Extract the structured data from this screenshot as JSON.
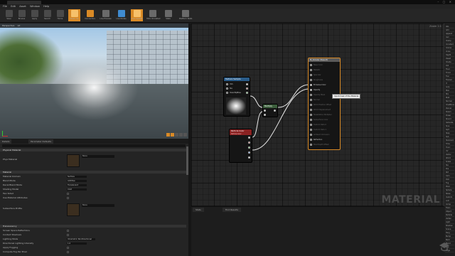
{
  "window": {
    "title_tab": "M_Smoke"
  },
  "menu": {
    "items": [
      "File",
      "Edit",
      "Asset",
      "Window",
      "Help"
    ]
  },
  "toolbar": {
    "buttons": [
      {
        "label": "Save",
        "icon": "save-icon"
      },
      {
        "label": "Browse",
        "icon": "browse-icon"
      },
      {
        "label": "Apply",
        "icon": "apply-icon"
      },
      {
        "label": "Search",
        "icon": "search-icon"
      },
      {
        "label": "Home",
        "icon": "home-icon"
      },
      {
        "label": "Clean Up",
        "icon": "cleanup-icon"
      },
      {
        "label": "Connectors",
        "icon": "connectors-icon"
      },
      {
        "label": "Live Preview",
        "icon": "live-preview-icon"
      },
      {
        "label": "Live Nodes",
        "icon": "live-nodes-icon"
      },
      {
        "label": "Live Update",
        "icon": "live-update-icon"
      },
      {
        "label": "Hide Unrelated",
        "icon": "hide-unrelated-icon"
      },
      {
        "label": "Stats",
        "icon": "stats-icon"
      },
      {
        "label": "Platform Stats",
        "icon": "platform-stats-icon"
      }
    ]
  },
  "viewport": {
    "labels": [
      "Perspective",
      "Lit"
    ]
  },
  "details": {
    "tabs": [
      "Details",
      "Parameter Defaults"
    ],
    "sections": {
      "physical": "Physical Material",
      "material": "Material",
      "translucency": "Translucency"
    },
    "physical_rows": [
      {
        "label": "Phys Material",
        "value": "None"
      }
    ],
    "material_rows": [
      {
        "label": "Material Domain",
        "value": "Surface",
        "kind": "select"
      },
      {
        "label": "Blend Mode",
        "value": "Additive",
        "kind": "select"
      },
      {
        "label": "Decal Blend Mode",
        "value": "Translucent",
        "kind": "select"
      },
      {
        "label": "Shading Model",
        "value": "Unlit",
        "kind": "select"
      },
      {
        "label": "Two Sided",
        "value": "",
        "kind": "check"
      },
      {
        "label": "Use Material Attributes",
        "value": "",
        "kind": "check"
      },
      {
        "label": "Subsurface Profile",
        "value": "None",
        "kind": "thumb"
      }
    ],
    "translucency_rows": [
      {
        "label": "Screen Space Reflections",
        "kind": "check"
      },
      {
        "label": "Contact Shadows",
        "kind": "check"
      },
      {
        "label": "Lighting Mode",
        "kind": "select",
        "value": "Volumetric NonDirectional"
      },
      {
        "label": "Directional Lighting Intensity",
        "kind": "select",
        "value": "1.0"
      },
      {
        "label": "Apply Fogging",
        "kind": "check"
      },
      {
        "label": "Compute Fog Per Pixel",
        "kind": "check"
      }
    ]
  },
  "graph": {
    "zoom": "Zoom 1:1",
    "watermark": "MATERIAL",
    "texture_node": {
      "title": "Texture Sample",
      "pins": [
        "UVs",
        "Tex",
        "View MipBias"
      ]
    },
    "multiply_node": {
      "title": "Multiply"
    },
    "particle_node": {
      "title": "Particle Color",
      "subtitle": "Particle Color"
    },
    "result_node": {
      "title": "M_Smoke (Result)",
      "pins": [
        "Base Color",
        "Metallic",
        "Specular",
        "Roughness",
        "Emissive Color",
        "Opacity",
        "Opacity Mask",
        "Normal",
        "World Position Offset",
        "World Displacement",
        "Tessellation Multiplier",
        "Subsurface Color",
        "Custom Data 0",
        "Custom Data 1",
        "Ambient Occlusion",
        "Refraction",
        "Pixel Depth Offset"
      ]
    },
    "tooltip": "Input mask of the Material"
  },
  "palette": {
    "items": [
      "Abs",
      "Add",
      "Append",
      "Ceil",
      "Clamp",
      "Constant",
      "Cosine",
      "Cross",
      "Depth",
      "Desat",
      "Divide",
      "Dot",
      "Floor",
      "Fmod",
      "Frac",
      "Fresnel",
      "If",
      "Lerp",
      "Max",
      "Min",
      "Mult",
      "Normal",
      "OneMinus",
      "Panner",
      "Param",
      "Power",
      "Round",
      "Saturate",
      "Sine",
      "Sqrt",
      "Step",
      "Sub",
      "TexCoord",
      "Time",
      "Trunc",
      "UV",
      "Vector",
      "World",
      "Scalar",
      "Tex",
      "Pos",
      "Rot",
      "Cam",
      "Dist",
      "Fog",
      "Pixel",
      "Sphere",
      "Noise",
      "Custom",
      "Lum",
      "Comp",
      "Trans",
      "Object",
      "Particle",
      "Vertex",
      "Light",
      "Shadow",
      "Scene",
      "Tang",
      "Bump",
      "Bent",
      "Blend",
      "Clip",
      "Edge"
    ]
  },
  "bottom": {
    "tabs": [
      "Stats",
      "Find Results"
    ]
  },
  "colors": {
    "accent": "#d98a26",
    "blue": "#3f8bd0",
    "texture_header": "#2a5c8a",
    "particle_header": "#8a2222"
  }
}
